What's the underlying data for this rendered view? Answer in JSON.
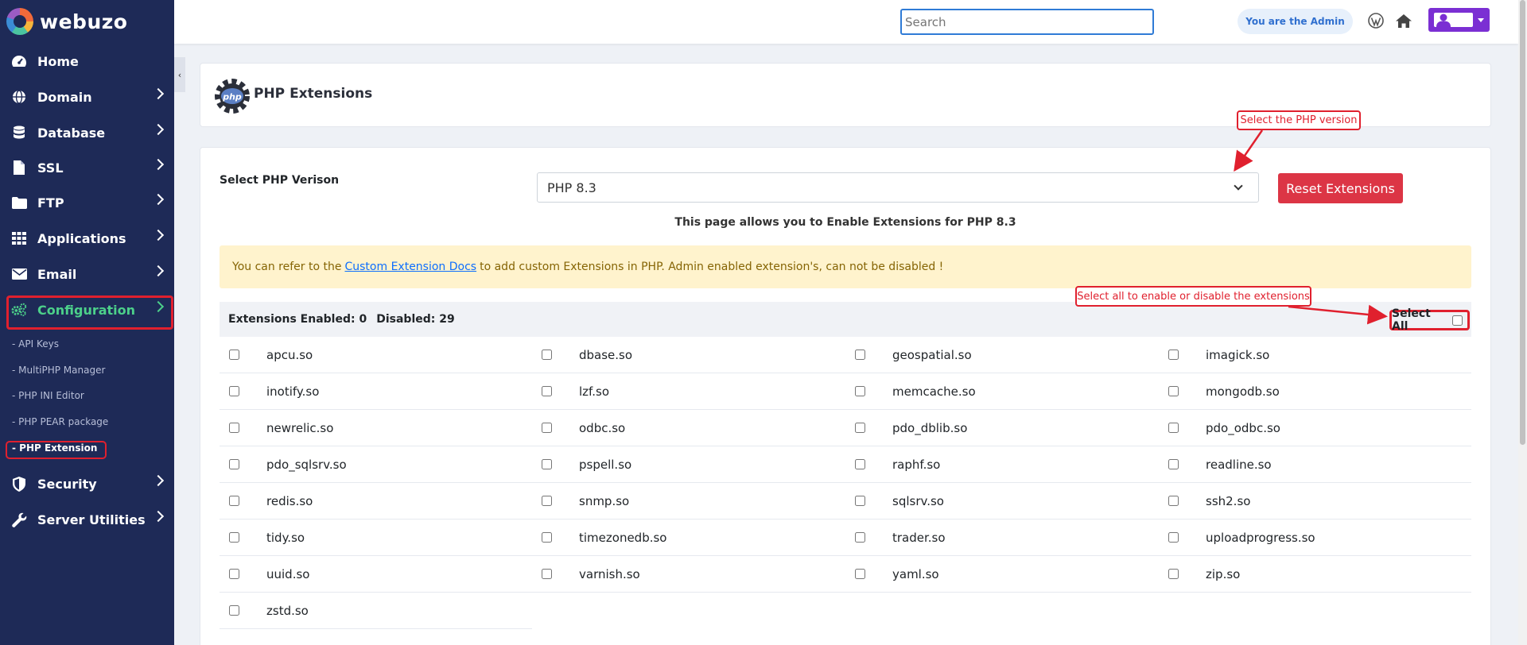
{
  "brand": {
    "name": "webuzo"
  },
  "sidebar": {
    "items": [
      {
        "label": "Home",
        "icon": "gauge-icon"
      },
      {
        "label": "Domain",
        "icon": "globe-icon"
      },
      {
        "label": "Database",
        "icon": "database-icon"
      },
      {
        "label": "SSL",
        "icon": "file-icon"
      },
      {
        "label": "FTP",
        "icon": "folder-icon"
      },
      {
        "label": "Applications",
        "icon": "grid-icon"
      },
      {
        "label": "Email",
        "icon": "envelope-icon"
      },
      {
        "label": "Configuration",
        "icon": "gears-icon"
      },
      {
        "label": "Security",
        "icon": "shield-icon"
      },
      {
        "label": "Server Utilities",
        "icon": "wrench-icon"
      }
    ],
    "sub_items": [
      "- API Keys",
      "- MultiPHP Manager",
      "- PHP INI Editor",
      "- PHP PEAR package",
      "- PHP Extension"
    ],
    "active_item": "Configuration",
    "active_sub_item": "- PHP Extension"
  },
  "topbar": {
    "search_placeholder": "Search",
    "admin_badge": "You are the Admin"
  },
  "page": {
    "title": "PHP Extensions",
    "select_label": "Select PHP Verison",
    "selected_version": "PHP 8.3",
    "reset_button": "Reset Extensions",
    "info_text": "This page allows you to Enable Extensions for PHP 8.3",
    "alert": {
      "before": "You can refer to the",
      "link": "Custom Extension Docs",
      "after": "to add custom Extensions in PHP. Admin enabled extension's, can not be disabled !"
    },
    "extensions_header": {
      "enabled_label": "Extensions Enabled:",
      "enabled_count": "0",
      "disabled_label": "Disabled:",
      "disabled_count": "29"
    },
    "select_all_label": "Select All",
    "extensions": [
      "apcu.so",
      "dbase.so",
      "geospatial.so",
      "imagick.so",
      "inotify.so",
      "lzf.so",
      "memcache.so",
      "mongodb.so",
      "newrelic.so",
      "odbc.so",
      "pdo_dblib.so",
      "pdo_odbc.so",
      "pdo_sqlsrv.so",
      "pspell.so",
      "raphf.so",
      "readline.so",
      "redis.so",
      "snmp.so",
      "sqlsrv.so",
      "ssh2.so",
      "tidy.so",
      "timezonedb.so",
      "trader.so",
      "uploadprogress.so",
      "uuid.so",
      "varnish.so",
      "yaml.so",
      "zip.so",
      "zstd.so"
    ]
  },
  "annotations": {
    "version_callout": "Select the PHP version",
    "select_all_callout": "Select all to enable or disable the extensions"
  },
  "colors": {
    "sidebar_bg": "#1e2a57",
    "active_green": "#4cd08a",
    "annotation_red": "#e0202e",
    "reset_red": "#dc3545",
    "user_purple": "#7b2fd3"
  }
}
